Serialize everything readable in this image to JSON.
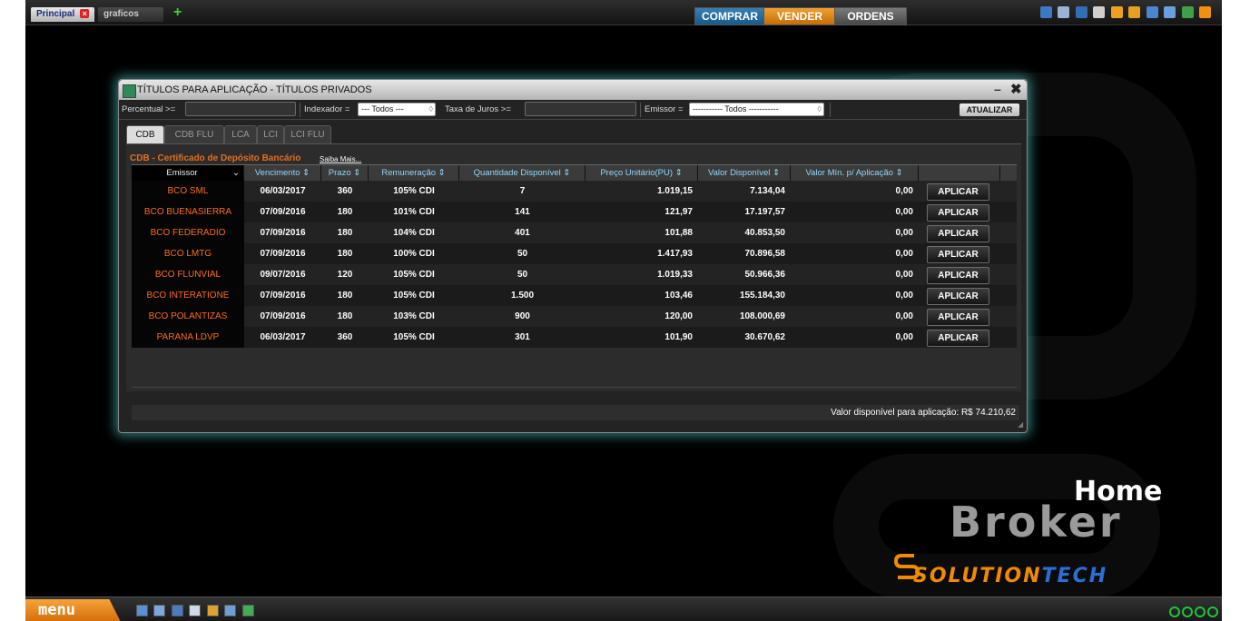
{
  "tabs": {
    "principal": "Principal",
    "graficos": "graficos",
    "add": "+"
  },
  "trade": {
    "comprar": "COMPRAR",
    "vender": "VENDER",
    "ordens": "ORDENS"
  },
  "window": {
    "title": "TÍTULOS PARA APLICAÇÃO - TÍTULOS PRIVADOS",
    "minimize": "–",
    "close": "✖"
  },
  "filters": {
    "percentual_label": "Percentual >=",
    "percentual_value": "",
    "indexador_label": "Indexador =",
    "indexador_value": "--- Todos ---",
    "taxa_label": "Taxa de Juros >=",
    "taxa_value": "",
    "emissor_label": "Emissor =",
    "emissor_value": "----------- Todos -----------",
    "atualizar": "ATUALIZAR"
  },
  "product_tabs": [
    "CDB",
    "CDB FLU",
    "LCA",
    "LCI",
    "LCI FLU"
  ],
  "section": {
    "title": "CDB - Certificado de Depósito Bancário",
    "link": "Saiba Mais..."
  },
  "table": {
    "headers": [
      "Emissor",
      "Vencimento",
      "Prazo",
      "Remuneração",
      "Quantidade Disponível",
      "Preço Unitário(PU)",
      "Valor Disponível",
      "Valor Mín. p/ Aplicação"
    ],
    "rows": [
      [
        "BCO SML",
        "06/03/2017",
        "360",
        "105% CDI",
        "7",
        "1.019,15",
        "7.134,04",
        "0,00"
      ],
      [
        "BCO BUENASIERRA",
        "07/09/2016",
        "180",
        "101% CDI",
        "141",
        "121,97",
        "17.197,57",
        "0,00"
      ],
      [
        "BCO FEDERADIO",
        "07/09/2016",
        "180",
        "104% CDI",
        "401",
        "101,88",
        "40.853,50",
        "0,00"
      ],
      [
        "BCO LMTG",
        "07/09/2016",
        "180",
        "100% CDI",
        "50",
        "1.417,93",
        "70.896,58",
        "0,00"
      ],
      [
        "BCO FLUNVIAL",
        "09/07/2016",
        "120",
        "105% CDI",
        "50",
        "1.019,33",
        "50.966,36",
        "0,00"
      ],
      [
        "BCO INTERATIONE",
        "07/09/2016",
        "180",
        "105% CDI",
        "1.500",
        "103,46",
        "155.184,30",
        "0,00"
      ],
      [
        "BCO POLANTIZAS",
        "07/09/2016",
        "180",
        "103% CDI",
        "900",
        "120,00",
        "108.000,69",
        "0,00"
      ],
      [
        "PARANA LDVP",
        "06/03/2017",
        "360",
        "105% CDI",
        "301",
        "101,90",
        "30.670,62",
        "0,00"
      ]
    ],
    "action_label": "APLICAR"
  },
  "status": {
    "text": "Valor disponível para aplicação: R$ 74.210,62"
  },
  "brand": {
    "home": "Home",
    "broker": "Broker",
    "solution": "SOLUTION",
    "tech": "TECH"
  },
  "bottom": {
    "menu": "menu"
  },
  "colors": {
    "accent_orange": "#e46f1a",
    "buy_blue": "#175a8c",
    "sell_orange": "#c46e06",
    "header_cyan": "#8fd8ff",
    "glow": "#5adcdc"
  }
}
